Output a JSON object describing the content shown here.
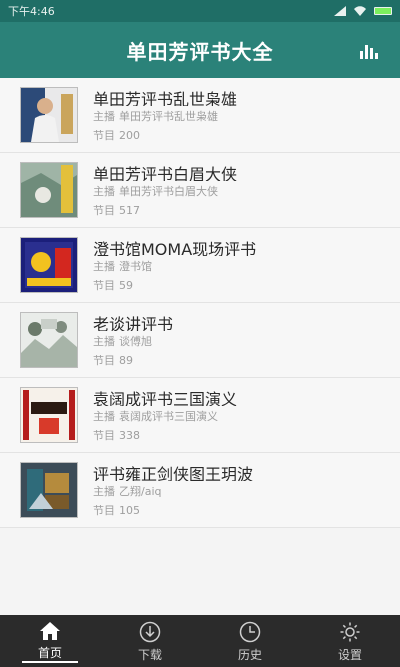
{
  "status": {
    "time": "下午4:46",
    "signal_text": "",
    "icons": [
      "wifi-icon",
      "signal-icon",
      "battery-icon"
    ]
  },
  "app": {
    "title": "单田芳评书大全",
    "action_icon": "chart-icon",
    "accent": "#2b8279"
  },
  "list": [
    {
      "title": "单田芳评书乱世枭雄",
      "host_label": "主播",
      "host": "单田芳评书乱世枭雄",
      "count_label": "节目",
      "count": "200"
    },
    {
      "title": "单田芳评书白眉大侠",
      "host_label": "主播",
      "host": "单田芳评书白眉大侠",
      "count_label": "节目",
      "count": "517"
    },
    {
      "title": "澄书馆MOMA现场评书",
      "host_label": "主播",
      "host": "澄书馆",
      "count_label": "节目",
      "count": "59"
    },
    {
      "title": "老谈讲评书",
      "host_label": "主播",
      "host": "谈傅旭",
      "count_label": "节目",
      "count": "89"
    },
    {
      "title": "袁阔成评书三国演义",
      "host_label": "主播",
      "host": "袁阔成评书三国演义",
      "count_label": "节目",
      "count": "338"
    },
    {
      "title": "评书雍正剑侠图王玥波",
      "host_label": "主播",
      "host": "乙翔/aiq",
      "count_label": "节目",
      "count": "105"
    }
  ],
  "tabs": [
    {
      "label": "首页",
      "icon": "home-icon",
      "active": true
    },
    {
      "label": "下载",
      "icon": "download-icon",
      "active": false
    },
    {
      "label": "历史",
      "icon": "clock-icon",
      "active": false
    },
    {
      "label": "设置",
      "icon": "gear-icon",
      "active": false
    }
  ]
}
